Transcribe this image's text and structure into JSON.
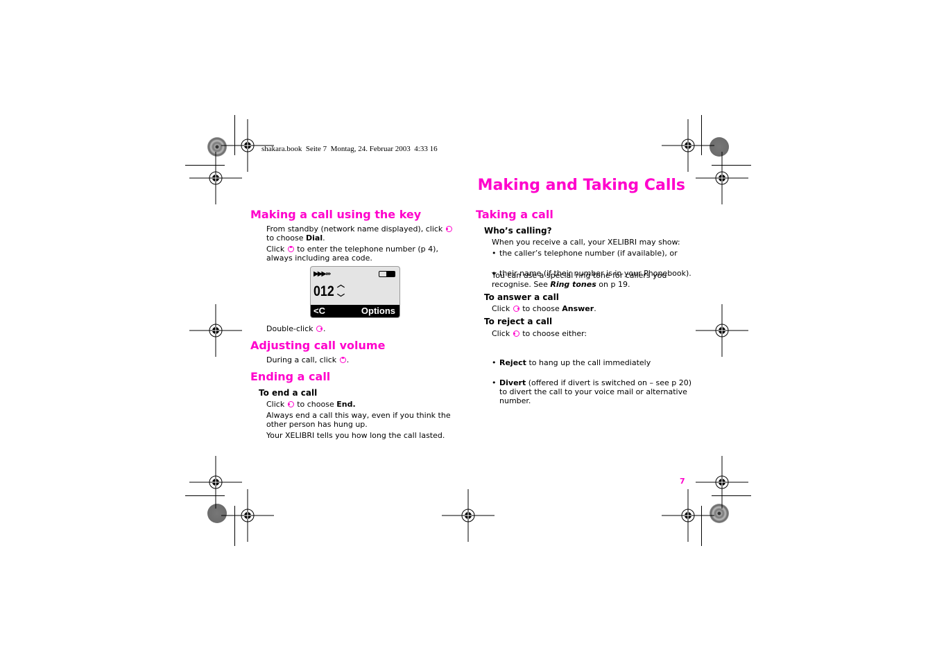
{
  "header": {
    "file_info": "shakara.book  Seite 7  Montag, 24. Februar 2003  4:33 16"
  },
  "page_title": "Making and Taking Calls",
  "page_number": "7",
  "accent_color": "#ff00cc",
  "left_column": {
    "making_call": {
      "heading": "Making a call using the key",
      "para1_a": "From standby (network name displayed), click ",
      "para1_b": " to choose ",
      "para1_bold": "Dial",
      "para1_c": ".",
      "para2_a": "Click ",
      "para2_b": " to enter the telephone number (p 4), always including area code.",
      "phone_display": {
        "signal": "▶▶▶›››",
        "number": "012",
        "up_arrow": "︿",
        "down_arrow": "﹀",
        "left_softkey": "<C",
        "right_softkey": "Options"
      },
      "para3_a": "Double-click ",
      "para3_b": "."
    },
    "adjusting_volume": {
      "heading": "Adjusting call volume",
      "para_a": "During a call, click ",
      "para_b": "."
    },
    "ending_call": {
      "heading": "Ending a call",
      "subheading": "To end a call",
      "para1_a": "Click ",
      "para1_b": " to choose ",
      "para1_bold": "End.",
      "para2": "Always end a call this way, even if you think the other person has hung up.",
      "para3": "Your XELIBRI tells you how long the call lasted."
    }
  },
  "right_column": {
    "taking_call": {
      "heading": "Taking a call",
      "whos_calling": {
        "subheading": "Who’s calling?",
        "intro": "When you receive a call, your XELIBRI may show:",
        "bullets": [
          "the caller’s telephone number (if available), or",
          "their name (if their number is in your Phonebook)."
        ],
        "ring_a": "You can use a special ring tone for callers you recognise. See ",
        "ring_link": "Ring tones",
        "ring_b": " on p 19."
      },
      "answer": {
        "subheading": "To answer a call",
        "para_a": "Click ",
        "para_b": " to choose ",
        "para_bold": "Answer",
        "para_c": "."
      },
      "reject": {
        "subheading": "To reject a call",
        "para_a": "Click ",
        "para_b": " to choose either:",
        "bullets": [
          {
            "bold": "Reject",
            "text": " to hang up the call immediately"
          },
          {
            "bold": "Divert",
            "text": " (offered if divert is switched on – see p 20) to divert the call to your voice mail or alternative number."
          }
        ]
      }
    }
  }
}
